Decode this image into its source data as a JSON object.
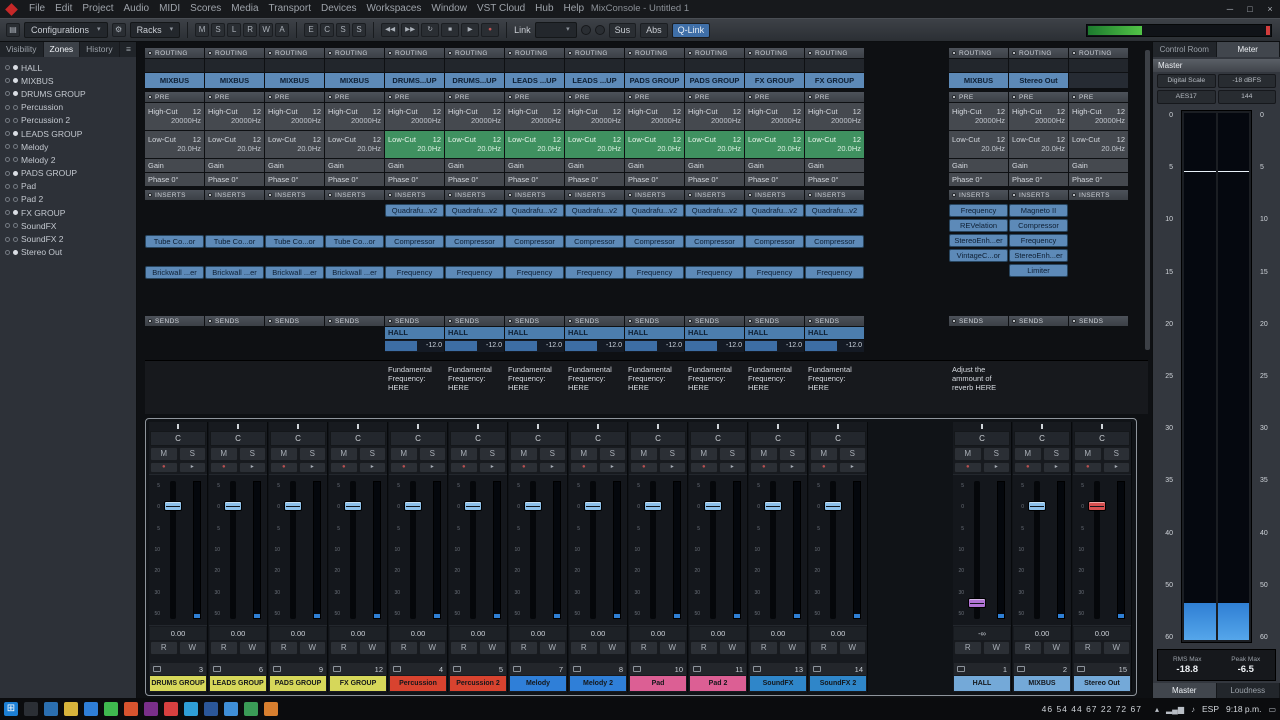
{
  "window": {
    "title": "MixConsole - Untitled 1",
    "menus": [
      "File",
      "Edit",
      "Project",
      "Audio",
      "MIDI",
      "Scores",
      "Media",
      "Transport",
      "Devices",
      "Workspaces",
      "Window",
      "VST Cloud",
      "Hub",
      "Help"
    ],
    "minimize": "─",
    "maximize": "□",
    "close": "×"
  },
  "toolbar": {
    "configurations_label": "Configurations",
    "racks_label": "Racks",
    "state_buttons": [
      "M",
      "S",
      "L",
      "R",
      "W",
      "A"
    ],
    "view_buttons": [
      "E",
      "C",
      "S",
      "S"
    ],
    "transport": [
      {
        "name": "goto-previous-button",
        "glyph": "◀◀"
      },
      {
        "name": "goto-next-button",
        "glyph": "▶▶"
      },
      {
        "name": "cycle-button",
        "glyph": "↻"
      },
      {
        "name": "stop-button",
        "glyph": "■"
      },
      {
        "name": "play-button",
        "glyph": "▶"
      },
      {
        "name": "record-button",
        "glyph": "●"
      }
    ],
    "link_label": "Link",
    "sus_label": "Sus",
    "abs_label": "Abs",
    "qlink_label": "Q-Link"
  },
  "sidebar": {
    "tabs": [
      "Visibility",
      "Zones",
      "History"
    ],
    "active_tab": "Zones",
    "menu_icon": "≡",
    "channels": [
      {
        "label": "HALL",
        "pinned": true
      },
      {
        "label": "MIXBUS",
        "pinned": true
      },
      {
        "label": "DRUMS GROUP",
        "pinned": true
      },
      {
        "label": "Percussion",
        "pinned": false
      },
      {
        "label": "Percussion 2",
        "pinned": false
      },
      {
        "label": "LEADS GROUP",
        "pinned": true
      },
      {
        "label": "Melody",
        "pinned": false
      },
      {
        "label": "Melody 2",
        "pinned": false
      },
      {
        "label": "PADS GROUP",
        "pinned": true
      },
      {
        "label": "Pad",
        "pinned": false
      },
      {
        "label": "Pad 2",
        "pinned": false
      },
      {
        "label": "FX GROUP",
        "pinned": true
      },
      {
        "label": "SoundFX",
        "pinned": false
      },
      {
        "label": "SoundFX 2",
        "pinned": false
      },
      {
        "label": "Stereo Out",
        "pinned": true
      }
    ]
  },
  "racks": {
    "routing_label": "ROUTING",
    "pre_label": "PRE",
    "inserts_label": "INSERTS",
    "sends_label": "SENDS"
  },
  "pre": {
    "highcut_label": "High-Cut",
    "slope": "12",
    "highcut_value": "20000Hz",
    "lowcut_label": "Low-Cut",
    "lowcut_value": "20.0Hz",
    "gain_label": "Gain",
    "phase_label": "Phase 0°"
  },
  "fader_section": {
    "pan_center": "C",
    "mute": "M",
    "solo": "S",
    "read": "R",
    "write": "W",
    "record_glyph": "●",
    "monitor_glyph": "▸",
    "scale": [
      "5",
      "0",
      "5",
      "10",
      "20",
      "30",
      "50"
    ]
  },
  "channels": [
    {
      "name": "DRUMS GROUP",
      "number": "3",
      "zone": "left",
      "color": "#d6d75a",
      "routing": "MIXBUS",
      "lowcut_active": false,
      "inserts": [
        "",
        "Tube Co...or",
        "Brickwall ...er"
      ],
      "inserts_compact": false,
      "send_dest": "",
      "send_value": "",
      "note": "",
      "fader_value": "0.00",
      "cap_color": "#8cc0ea",
      "cap_pos": 0.17
    },
    {
      "name": "LEADS GROUP",
      "number": "6",
      "zone": "left",
      "color": "#d6d75a",
      "routing": "MIXBUS",
      "lowcut_active": false,
      "inserts": [
        "",
        "Tube Co...or",
        "Brickwall ...er"
      ],
      "inserts_compact": false,
      "send_dest": "",
      "send_value": "",
      "note": "",
      "fader_value": "0.00",
      "cap_color": "#8cc0ea",
      "cap_pos": 0.17
    },
    {
      "name": "PADS GROUP",
      "number": "9",
      "zone": "left",
      "color": "#d6d75a",
      "routing": "MIXBUS",
      "lowcut_active": false,
      "inserts": [
        "",
        "Tube Co...or",
        "Brickwall ...er"
      ],
      "inserts_compact": false,
      "send_dest": "",
      "send_value": "",
      "note": "",
      "fader_value": "0.00",
      "cap_color": "#8cc0ea",
      "cap_pos": 0.17
    },
    {
      "name": "FX GROUP",
      "number": "12",
      "zone": "left",
      "color": "#d6d75a",
      "routing": "MIXBUS",
      "lowcut_active": false,
      "inserts": [
        "",
        "Tube Co...or",
        "Brickwall ...er"
      ],
      "inserts_compact": false,
      "send_dest": "",
      "send_value": "",
      "note": "",
      "fader_value": "0.00",
      "cap_color": "#8cc0ea",
      "cap_pos": 0.17
    },
    {
      "name": "Percussion",
      "number": "4",
      "zone": "left",
      "color": "#d8432f",
      "routing": "DRUMS...UP",
      "lowcut_active": true,
      "inserts": [
        "Quadrafu...v2",
        "Compressor",
        "Frequency"
      ],
      "inserts_compact": false,
      "send_dest": "HALL",
      "send_value": "-12.0",
      "note": "Fundamental Frequency: HERE",
      "fader_value": "0.00",
      "cap_color": "#8cc0ea",
      "cap_pos": 0.17
    },
    {
      "name": "Percussion 2",
      "number": "5",
      "zone": "left",
      "color": "#d8432f",
      "routing": "DRUMS...UP",
      "lowcut_active": true,
      "inserts": [
        "Quadrafu...v2",
        "Compressor",
        "Frequency"
      ],
      "inserts_compact": false,
      "send_dest": "HALL",
      "send_value": "-12.0",
      "note": "Fundamental Frequency: HERE",
      "fader_value": "0.00",
      "cap_color": "#8cc0ea",
      "cap_pos": 0.17
    },
    {
      "name": "Melody",
      "number": "7",
      "zone": "left",
      "color": "#2f7fd8",
      "routing": "LEADS ...UP",
      "lowcut_active": true,
      "inserts": [
        "Quadrafu...v2",
        "Compressor",
        "Frequency"
      ],
      "inserts_compact": false,
      "send_dest": "HALL",
      "send_value": "-12.0",
      "note": "Fundamental Frequency: HERE",
      "fader_value": "0.00",
      "cap_color": "#8cc0ea",
      "cap_pos": 0.17
    },
    {
      "name": "Melody 2",
      "number": "8",
      "zone": "left",
      "color": "#2f7fd8",
      "routing": "LEADS ...UP",
      "lowcut_active": true,
      "inserts": [
        "Quadrafu...v2",
        "Compressor",
        "Frequency"
      ],
      "inserts_compact": false,
      "send_dest": "HALL",
      "send_value": "-12.0",
      "note": "Fundamental Frequency: HERE",
      "fader_value": "0.00",
      "cap_color": "#8cc0ea",
      "cap_pos": 0.17
    },
    {
      "name": "Pad",
      "number": "10",
      "zone": "left",
      "color": "#dc5f94",
      "routing": "PADS GROUP",
      "lowcut_active": true,
      "inserts": [
        "Quadrafu...v2",
        "Compressor",
        "Frequency"
      ],
      "inserts_compact": false,
      "send_dest": "HALL",
      "send_value": "-12.0",
      "note": "Fundamental Frequency: HERE",
      "fader_value": "0.00",
      "cap_color": "#8cc0ea",
      "cap_pos": 0.17
    },
    {
      "name": "Pad 2",
      "number": "11",
      "zone": "left",
      "color": "#dc5f94",
      "routing": "PADS GROUP",
      "lowcut_active": true,
      "inserts": [
        "Quadrafu...v2",
        "Compressor",
        "Frequency"
      ],
      "inserts_compact": false,
      "send_dest": "HALL",
      "send_value": "-12.0",
      "note": "Fundamental Frequency: HERE",
      "fader_value": "0.00",
      "cap_color": "#8cc0ea",
      "cap_pos": 0.17
    },
    {
      "name": "SoundFX",
      "number": "13",
      "zone": "left",
      "color": "#2f86c9",
      "routing": "FX GROUP",
      "lowcut_active": true,
      "inserts": [
        "Quadrafu...v2",
        "Compressor",
        "Frequency"
      ],
      "inserts_compact": false,
      "send_dest": "HALL",
      "send_value": "-12.0",
      "note": "Fundamental Frequency: HERE",
      "fader_value": "0.00",
      "cap_color": "#8cc0ea",
      "cap_pos": 0.17
    },
    {
      "name": "SoundFX 2",
      "number": "14",
      "zone": "left",
      "color": "#2f86c9",
      "routing": "FX GROUP",
      "lowcut_active": true,
      "inserts": [
        "Quadrafu...v2",
        "Compressor",
        "Frequency"
      ],
      "inserts_compact": false,
      "send_dest": "HALL",
      "send_value": "-12.0",
      "note": "Fundamental Frequency: HERE",
      "fader_value": "0.00",
      "cap_color": "#8cc0ea",
      "cap_pos": 0.17
    },
    {
      "name": "HALL",
      "number": "1",
      "zone": "right",
      "color": "#74a9d8",
      "routing": "MIXBUS",
      "lowcut_active": false,
      "inserts": [
        "Frequency",
        "REVelation",
        "StereoEnh...er",
        "VintageC...or"
      ],
      "inserts_compact": true,
      "send_dest": "",
      "send_value": "",
      "note": "Adjust the ammount of reverb HERE",
      "fader_value": "-∞",
      "cap_color": "#b174d4",
      "cap_pos": 0.82
    },
    {
      "name": "MIXBUS",
      "number": "2",
      "zone": "right",
      "color": "#74a9d8",
      "routing": "Stereo Out",
      "lowcut_active": false,
      "inserts": [
        "Magneto II",
        "Compressor",
        "Frequency",
        "StereoEnh...er",
        "Limiter"
      ],
      "inserts_compact": true,
      "send_dest": "",
      "send_value": "",
      "note": "",
      "fader_value": "0.00",
      "cap_color": "#8cc0ea",
      "cap_pos": 0.17
    },
    {
      "name": "Stereo Out",
      "number": "15",
      "zone": "right",
      "color": "#74a9d8",
      "routing": "",
      "lowcut_active": false,
      "inserts": [],
      "inserts_compact": true,
      "send_dest": "",
      "send_value": "",
      "note": "",
      "fader_value": "0.00",
      "cap_color": "#d85050",
      "cap_pos": 0.17
    }
  ],
  "meter_panel": {
    "tabs": [
      "Control Room",
      "Meter"
    ],
    "active_tab": "Meter",
    "target": "Master",
    "buttons_row1": [
      "Digital Scale",
      "-18 dBFS"
    ],
    "buttons_row2": [
      "AES17",
      "144"
    ],
    "scale": [
      "0",
      "5",
      "10",
      "15",
      "20",
      "25",
      "30",
      "35",
      "40",
      "50",
      "60"
    ],
    "rms_max_label": "RMS Max",
    "rms_max_value": "-18.8",
    "peak_max_label": "Peak Max",
    "peak_max_value": "-6.5",
    "bottom_tabs": [
      "Master",
      "Loudness"
    ],
    "active_bottom_tab": "Master"
  },
  "taskbar": {
    "icons": [
      {
        "name": "start-button",
        "color": "#1c7fd4",
        "glyph": "⊞"
      },
      {
        "name": "search-icon",
        "color": "#2b2f35",
        "glyph": ""
      },
      {
        "name": "task-view-icon",
        "color": "#2b6fb0",
        "glyph": ""
      },
      {
        "name": "file-explorer-icon",
        "color": "#d8b43c",
        "glyph": ""
      },
      {
        "name": "edge-browser-icon",
        "color": "#2f7fd8",
        "glyph": ""
      },
      {
        "name": "whatsapp-icon",
        "color": "#3fba4f",
        "glyph": ""
      },
      {
        "name": "firefox-icon",
        "color": "#d8542f",
        "glyph": ""
      },
      {
        "name": "media-player-icon",
        "color": "#7a2f8a",
        "glyph": ""
      },
      {
        "name": "chrome-icon",
        "color": "#d84040",
        "glyph": ""
      },
      {
        "name": "telegram-icon",
        "color": "#2f9fd8",
        "glyph": ""
      },
      {
        "name": "word-icon",
        "color": "#2b579a",
        "glyph": ""
      },
      {
        "name": "photos-icon",
        "color": "#3f8fd8",
        "glyph": ""
      },
      {
        "name": "recorder-icon",
        "color": "#3a9b56",
        "glyph": ""
      },
      {
        "name": "vlc-icon",
        "color": "#d87f2f",
        "glyph": ""
      }
    ],
    "stats": "46 54 44 67 22 72 67",
    "tray_chevron": "▴",
    "tray_network": "▂▄▆",
    "tray_volume": "♪",
    "tray_lang": "ESP",
    "tray_time": "9:18 p.m.",
    "tray_notification": "▭"
  }
}
